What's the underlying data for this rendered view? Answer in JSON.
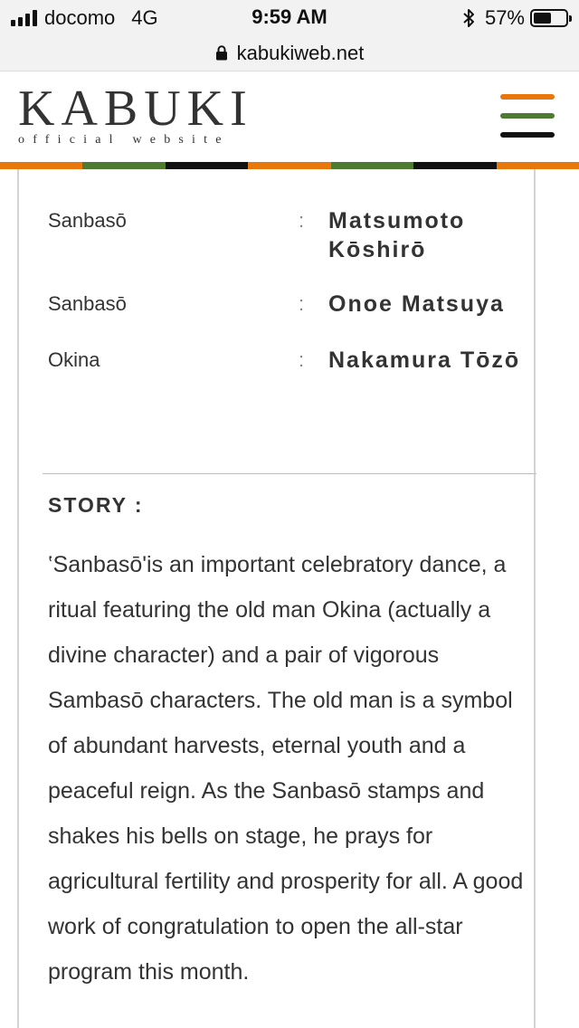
{
  "status_bar": {
    "carrier": "docomo",
    "network": "4G",
    "time": "9:59 AM",
    "battery_percent": "57%",
    "battery_level": 0.57
  },
  "browser": {
    "url": "kabukiweb.net"
  },
  "header": {
    "logo_title": "KABUKI",
    "logo_subtitle": "official website",
    "menu_line_colors": [
      "#e8780c",
      "#4f7a32",
      "#111111"
    ]
  },
  "stripe_colors": [
    "#e8780c",
    "#4f7a32",
    "#111111",
    "#e8780c",
    "#4f7a32",
    "#111111",
    "#e8780c"
  ],
  "cast": [
    {
      "role": "Sanbasō",
      "colon": ":",
      "actor": "Matsumoto Kōshirō"
    },
    {
      "role": "Sanbasō",
      "colon": ":",
      "actor": "Onoe Matsuya"
    },
    {
      "role": "Okina",
      "colon": ":",
      "actor": "Nakamura Tōzō"
    }
  ],
  "story": {
    "heading": "STORY :",
    "body": "‛Sanbasō'is an important celebratory dance, a ritual featuring the old man Okina (actually a divine character) and a pair of vigorous Sambasō characters. The old man is a symbol of abundant harvests, eternal youth and a peaceful reign. As the Sanbasō stamps and shakes his bells on stage, he prays for agricultural fertility and prosperity for all. A good work of congratulation to open the all-star program this month."
  }
}
